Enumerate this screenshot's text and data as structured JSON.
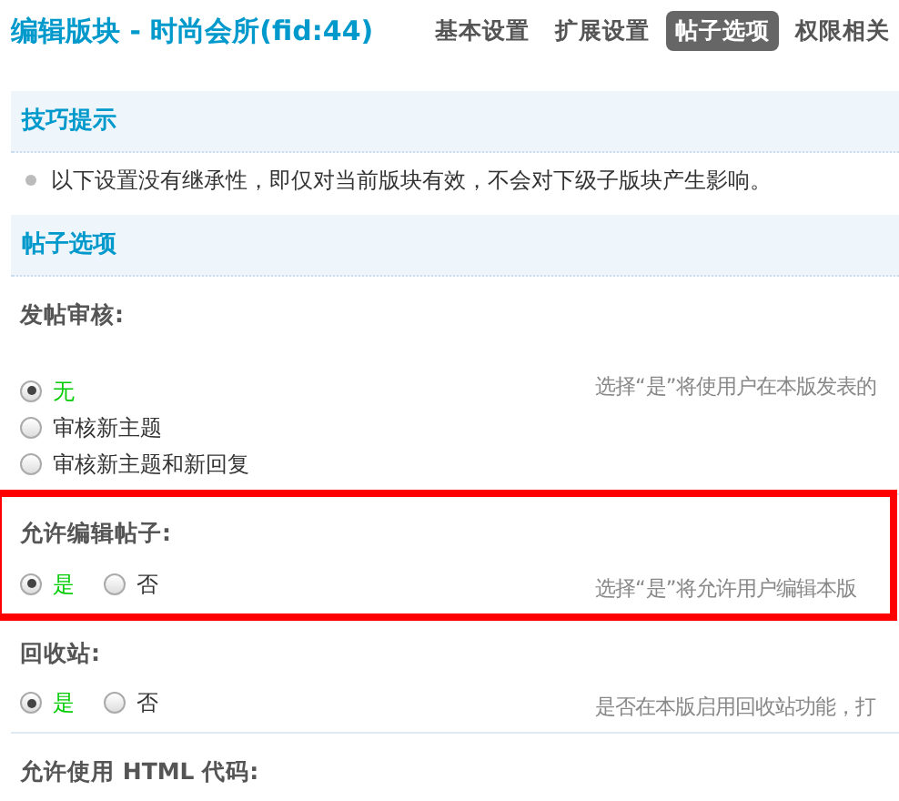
{
  "title": "编辑版块 - 时尚会所(fid:44)",
  "tabs": [
    {
      "label": "基本设置",
      "selected": false
    },
    {
      "label": "扩展设置",
      "selected": false
    },
    {
      "label": "帖子选项",
      "selected": true
    },
    {
      "label": "权限相关",
      "selected": false
    }
  ],
  "tips": {
    "heading": "技巧提示",
    "items": [
      "以下设置没有继承性，即仅对当前版块有效，不会对下级子版块产生影响。"
    ]
  },
  "section": {
    "heading": "帖子选项"
  },
  "settings": [
    {
      "label": "发帖审核:",
      "kind": "stacked",
      "highlighted": false,
      "options": [
        {
          "label": "无",
          "selected": true
        },
        {
          "label": "审核新主题",
          "selected": false
        },
        {
          "label": "审核新主题和新回复",
          "selected": false
        }
      ],
      "description": "选择“是”将使用户在本版发表的"
    },
    {
      "label": "允许编辑帖子:",
      "kind": "inline",
      "highlighted": true,
      "options": [
        {
          "label": "是",
          "selected": true
        },
        {
          "label": "否",
          "selected": false
        }
      ],
      "description": "选择“是”将允许用户编辑本版"
    },
    {
      "label": "回收站:",
      "kind": "inline",
      "highlighted": false,
      "options": [
        {
          "label": "是",
          "selected": true
        },
        {
          "label": "否",
          "selected": false
        }
      ],
      "description": "是否在本版启用回收站功能，打"
    },
    {
      "label": "允许使用 HTML 代码:",
      "highlighted": false
    }
  ]
}
